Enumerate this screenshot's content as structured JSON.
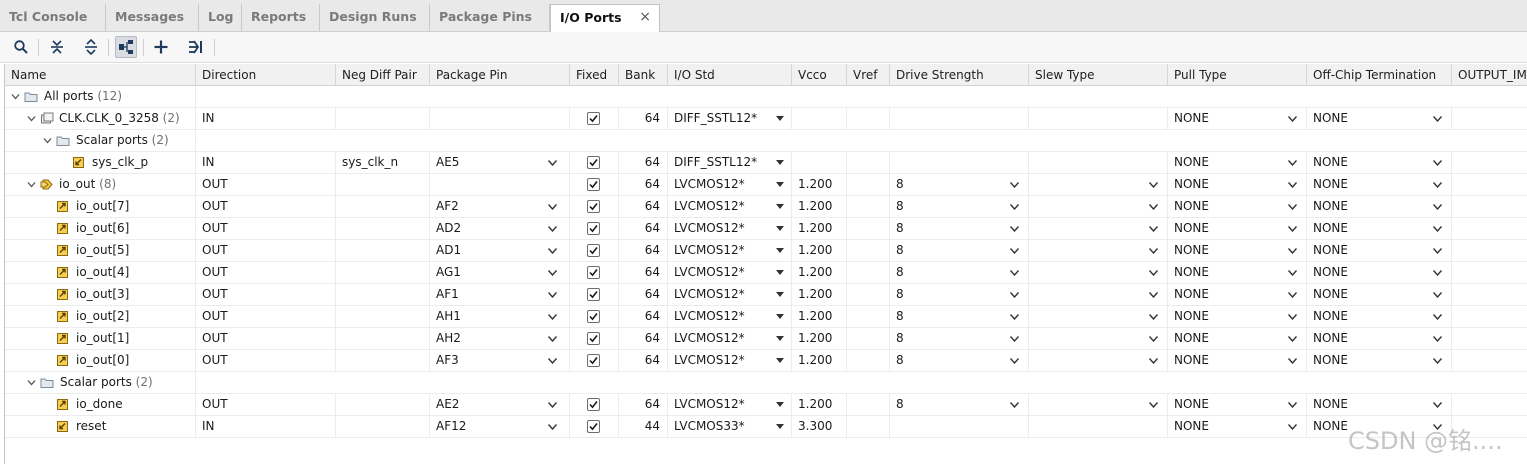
{
  "tabs": [
    {
      "label": "Tcl Console"
    },
    {
      "label": "Messages"
    },
    {
      "label": "Log"
    },
    {
      "label": "Reports"
    },
    {
      "label": "Design Runs"
    },
    {
      "label": "Package Pins"
    },
    {
      "label": "I/O Ports",
      "active": true
    }
  ],
  "toolbar": {
    "icons": [
      "search-icon",
      "collapse-all-icon",
      "expand-all-icon",
      "group-by-interface-icon",
      "add-icon",
      "auto-assign-icon"
    ]
  },
  "columns": [
    "Name",
    "Direction",
    "Neg Diff Pair",
    "Package Pin",
    "Fixed",
    "Bank",
    "I/O Std",
    "Vcco",
    "Vref",
    "Drive Strength",
    "Slew Type",
    "Pull Type",
    "Off-Chip Termination",
    "OUTPUT_IMP"
  ],
  "rows": [
    {
      "name": "All ports",
      "count": "(12)",
      "indent": 0,
      "expanded": true,
      "icon": "folder-icon"
    },
    {
      "name": "CLK.CLK_0_3258",
      "count": "(2)",
      "indent": 1,
      "expanded": true,
      "icon": "diff-pair-bus-icon",
      "direction": "IN",
      "fixed": true,
      "bank": "64",
      "io_std": "DIFF_SSTL12*",
      "io_std_dd": true,
      "pull": "NONE",
      "term": "NONE"
    },
    {
      "name": "Scalar ports",
      "count": "(2)",
      "indent": 2,
      "expanded": true,
      "icon": "folder-icon"
    },
    {
      "name": "sys_clk_p",
      "indent": 3,
      "icon": "port-in-icon",
      "direction": "IN",
      "neg": "sys_clk_n",
      "pin": "AE5",
      "fixed": true,
      "bank": "64",
      "io_std": "DIFF_SSTL12*",
      "io_std_dd": true,
      "pull": "NONE",
      "term": "NONE"
    },
    {
      "name": "io_out",
      "count": "(8)",
      "indent": 1,
      "expanded": true,
      "icon": "bus-out-icon",
      "direction": "OUT",
      "fixed": true,
      "bank": "64",
      "io_std": "LVCMOS12*",
      "io_std_dd": true,
      "vcco": "1.200",
      "drive": "8",
      "slew_dd": true,
      "pull": "NONE",
      "term": "NONE"
    },
    {
      "name": "io_out[7]",
      "indent": 2,
      "icon": "port-out-icon",
      "direction": "OUT",
      "pin": "AF2",
      "fixed": true,
      "bank": "64",
      "io_std": "LVCMOS12*",
      "io_std_dd": true,
      "vcco": "1.200",
      "drive": "8",
      "slew_dd": true,
      "pull": "NONE",
      "term": "NONE"
    },
    {
      "name": "io_out[6]",
      "indent": 2,
      "icon": "port-out-icon",
      "direction": "OUT",
      "pin": "AD2",
      "fixed": true,
      "bank": "64",
      "io_std": "LVCMOS12*",
      "io_std_dd": true,
      "vcco": "1.200",
      "drive": "8",
      "slew_dd": true,
      "pull": "NONE",
      "term": "NONE"
    },
    {
      "name": "io_out[5]",
      "indent": 2,
      "icon": "port-out-icon",
      "direction": "OUT",
      "pin": "AD1",
      "fixed": true,
      "bank": "64",
      "io_std": "LVCMOS12*",
      "io_std_dd": true,
      "vcco": "1.200",
      "drive": "8",
      "slew_dd": true,
      "pull": "NONE",
      "term": "NONE"
    },
    {
      "name": "io_out[4]",
      "indent": 2,
      "icon": "port-out-icon",
      "direction": "OUT",
      "pin": "AG1",
      "fixed": true,
      "bank": "64",
      "io_std": "LVCMOS12*",
      "io_std_dd": true,
      "vcco": "1.200",
      "drive": "8",
      "slew_dd": true,
      "pull": "NONE",
      "term": "NONE"
    },
    {
      "name": "io_out[3]",
      "indent": 2,
      "icon": "port-out-icon",
      "direction": "OUT",
      "pin": "AF1",
      "fixed": true,
      "bank": "64",
      "io_std": "LVCMOS12*",
      "io_std_dd": true,
      "vcco": "1.200",
      "drive": "8",
      "slew_dd": true,
      "pull": "NONE",
      "term": "NONE"
    },
    {
      "name": "io_out[2]",
      "indent": 2,
      "icon": "port-out-icon",
      "direction": "OUT",
      "pin": "AH1",
      "fixed": true,
      "bank": "64",
      "io_std": "LVCMOS12*",
      "io_std_dd": true,
      "vcco": "1.200",
      "drive": "8",
      "slew_dd": true,
      "pull": "NONE",
      "term": "NONE"
    },
    {
      "name": "io_out[1]",
      "indent": 2,
      "icon": "port-out-icon",
      "direction": "OUT",
      "pin": "AH2",
      "fixed": true,
      "bank": "64",
      "io_std": "LVCMOS12*",
      "io_std_dd": true,
      "vcco": "1.200",
      "drive": "8",
      "slew_dd": true,
      "pull": "NONE",
      "term": "NONE"
    },
    {
      "name": "io_out[0]",
      "indent": 2,
      "icon": "port-out-icon",
      "direction": "OUT",
      "pin": "AF3",
      "fixed": true,
      "bank": "64",
      "io_std": "LVCMOS12*",
      "io_std_dd": true,
      "vcco": "1.200",
      "drive": "8",
      "slew_dd": true,
      "pull": "NONE",
      "term": "NONE"
    },
    {
      "name": "Scalar ports",
      "count": "(2)",
      "indent": 1,
      "expanded": true,
      "icon": "folder-icon"
    },
    {
      "name": "io_done",
      "indent": 2,
      "icon": "port-out-icon",
      "direction": "OUT",
      "pin": "AE2",
      "fixed": true,
      "bank": "64",
      "io_std": "LVCMOS12*",
      "io_std_dd": true,
      "vcco": "1.200",
      "drive": "8",
      "slew_dd": true,
      "pull": "NONE",
      "term": "NONE"
    },
    {
      "name": "reset",
      "indent": 2,
      "icon": "port-in-icon",
      "direction": "IN",
      "pin": "AF12",
      "fixed": true,
      "bank": "44",
      "io_std": "LVCMOS33*",
      "io_std_dd": true,
      "vcco": "3.300",
      "pull": "NONE",
      "term": "NONE"
    }
  ],
  "watermark": "CSDN @铭...."
}
